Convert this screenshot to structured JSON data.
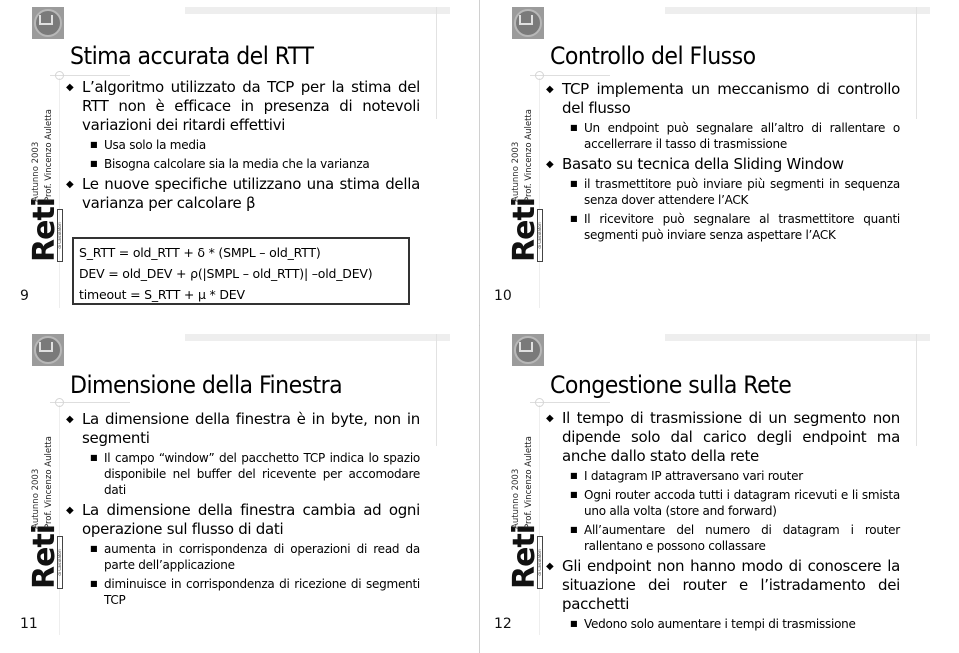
{
  "sidebar_brand": {
    "logo_text": "Reti",
    "logo_subtitle": "di Calcolatori",
    "term": "Autunno 2003",
    "author": "Prof. Vincenzo Auletta"
  },
  "slides": [
    {
      "number": "9",
      "title": "Stima accurata del RTT",
      "items": [
        {
          "level": 1,
          "text": "L’algoritmo utilizzato da TCP per la stima del RTT non è efficace in presenza di notevoli variazioni dei ritardi effettivi"
        },
        {
          "level": 2,
          "text": "Usa solo la media"
        },
        {
          "level": 2,
          "text": "Bisogna calcolare sia la media che la varianza"
        },
        {
          "level": 1,
          "text": "Le nuove specifiche utilizzano una stima della varianza per calcolare β"
        }
      ],
      "formulas": [
        "S_RTT = old_RTT + δ * (SMPL – old_RTT)",
        "DEV = old_DEV + ρ(|SMPL – old_RTT)| –old_DEV)",
        "timeout = S_RTT + μ * DEV"
      ]
    },
    {
      "number": "10",
      "title": "Controllo del Flusso",
      "items": [
        {
          "level": 1,
          "text": "TCP implementa un meccanismo di controllo del flusso"
        },
        {
          "level": 2,
          "text": "Un endpoint può segnalare all’altro di rallentare o accellerrare il tasso di trasmissione"
        },
        {
          "level": 1,
          "text": "Basato su tecnica della Sliding Window"
        },
        {
          "level": 2,
          "text": "il trasmettitore può inviare più segmenti in sequenza senza dover attendere l’ACK"
        },
        {
          "level": 2,
          "text": "Il ricevitore può segnalare al trasmettitore quanti segmenti può inviare senza aspettare l’ACK"
        }
      ]
    },
    {
      "number": "11",
      "title": "Dimensione della Finestra",
      "items": [
        {
          "level": 1,
          "text": "La dimensione della finestra è in byte, non in segmenti"
        },
        {
          "level": 2,
          "text": "Il campo “window” del pacchetto TCP indica lo spazio disponibile nel buffer del ricevente per accomodare dati"
        },
        {
          "level": 1,
          "text": "La dimensione della finestra cambia ad ogni operazione sul flusso di dati"
        },
        {
          "level": 2,
          "text": "aumenta in corrispondenza di operazioni di read da parte dell’applicazione"
        },
        {
          "level": 2,
          "text": "diminuisce in corrispondenza di ricezione di segmenti TCP"
        }
      ]
    },
    {
      "number": "12",
      "title": "Congestione sulla Rete",
      "items": [
        {
          "level": 1,
          "text": "Il tempo di trasmissione di un segmento non dipende solo dal carico degli endpoint ma anche dallo stato della rete"
        },
        {
          "level": 2,
          "text": "I datagram IP attraversano vari router"
        },
        {
          "level": 2,
          "text": "Ogni router accoda tutti i datagram ricevuti e li smista uno alla volta (store and forward)"
        },
        {
          "level": 2,
          "text": "All’aumentare del numero di datagram i router rallentano e possono collassare"
        },
        {
          "level": 1,
          "text": "Gli endpoint non hanno modo di conoscere la situazione dei router e l’istradamento dei pacchetti"
        },
        {
          "level": 2,
          "text": "Vedono solo aumentare i tempi di trasmissione"
        }
      ]
    }
  ],
  "bullets": {
    "level1": "◆",
    "level2": "■"
  }
}
